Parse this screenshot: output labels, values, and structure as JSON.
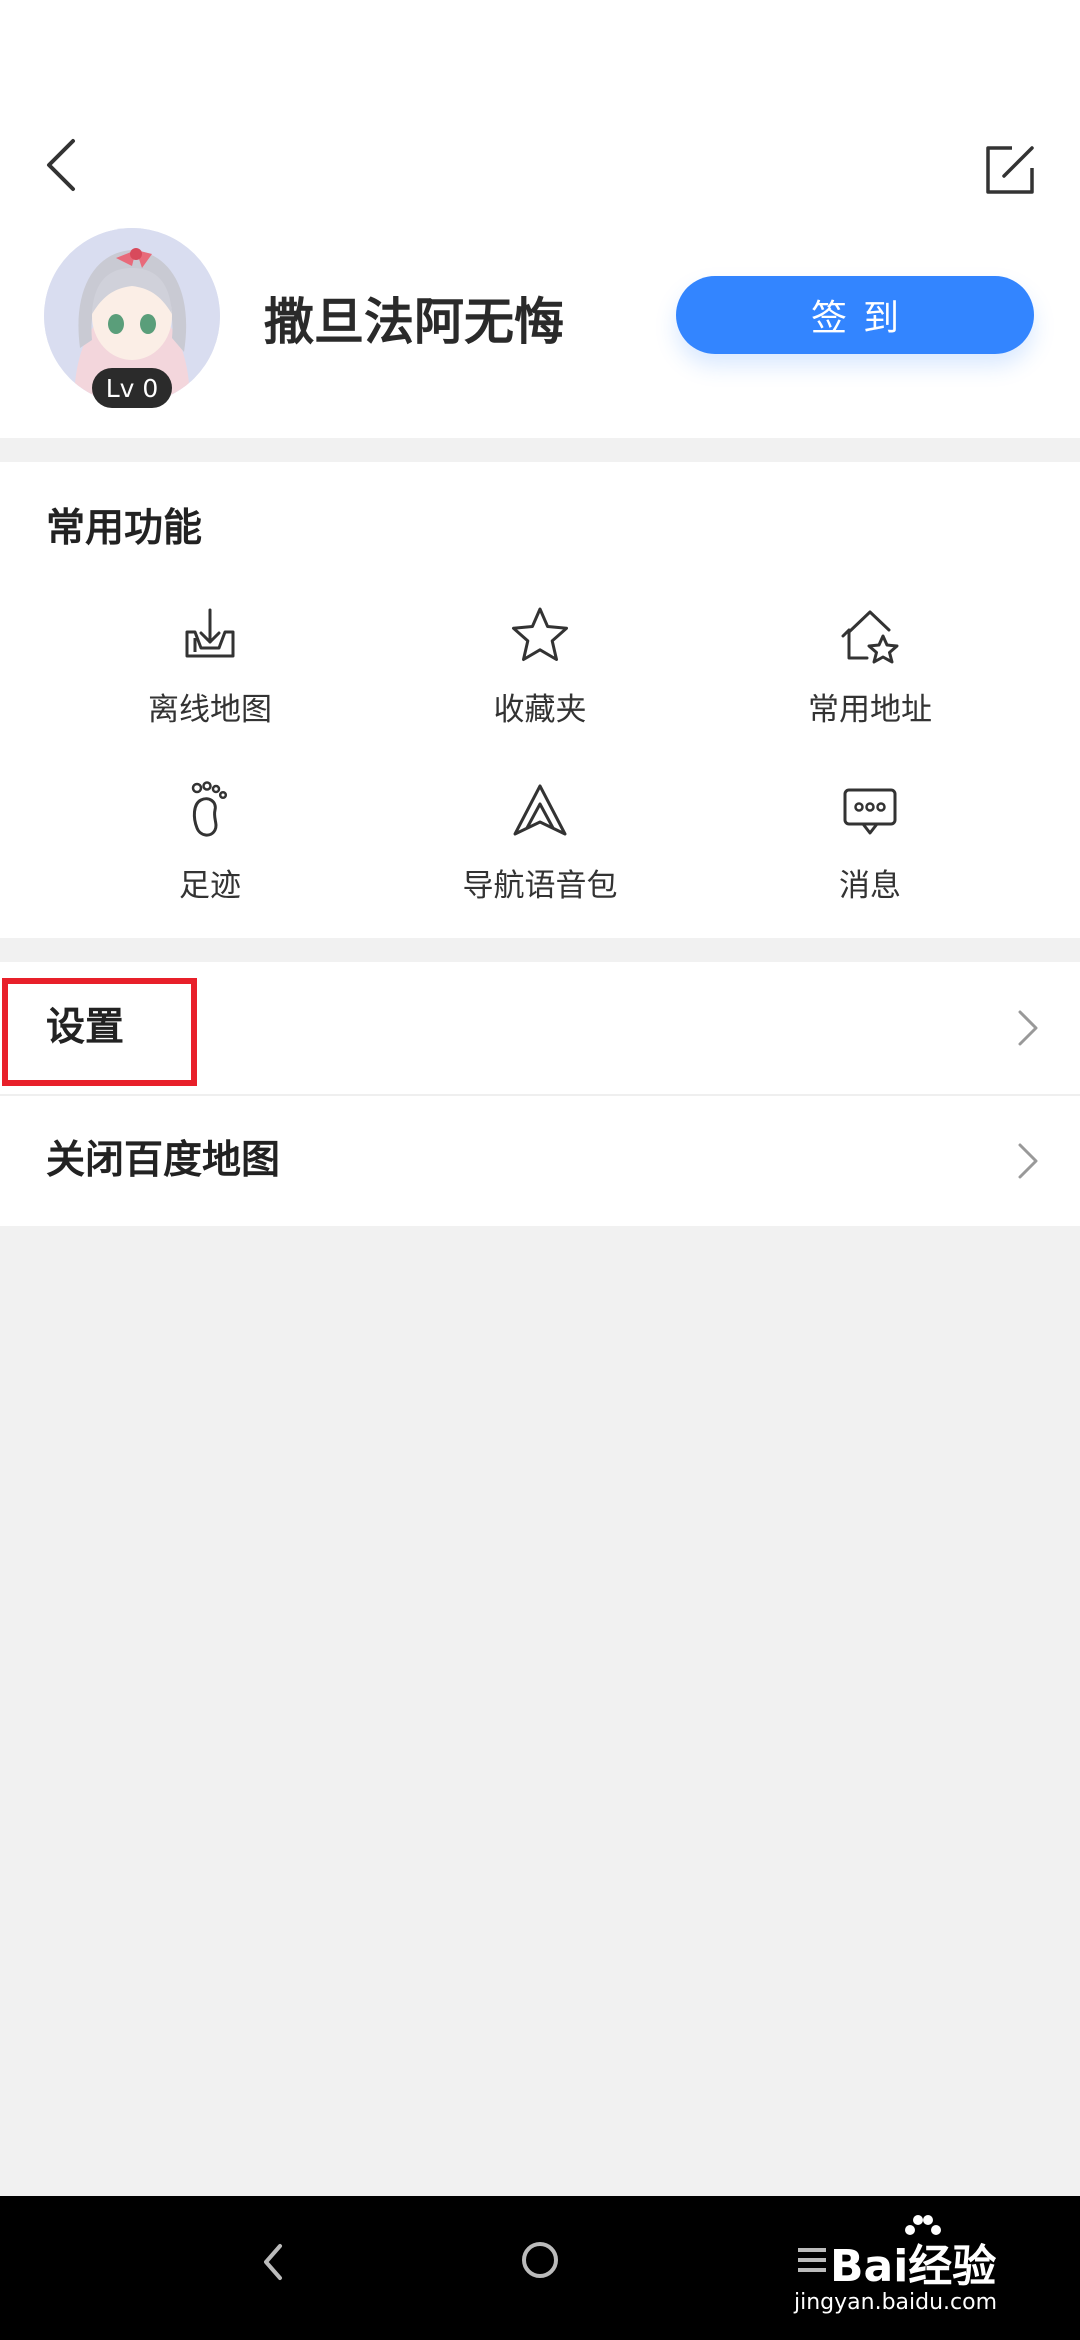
{
  "header": {
    "user_name": "撒旦法阿无悔",
    "level_badge": "Lv 0",
    "signin_label": "签到",
    "back_icon": "back-arrow-icon",
    "edit_icon": "edit-icon"
  },
  "common_functions": {
    "title": "常用功能",
    "items": [
      {
        "label": "离线地图",
        "icon": "offline-map-download-icon"
      },
      {
        "label": "收藏夹",
        "icon": "star-icon"
      },
      {
        "label": "常用地址",
        "icon": "home-star-icon"
      },
      {
        "label": "足迹",
        "icon": "footprint-icon"
      },
      {
        "label": "导航语音包",
        "icon": "navigation-arrow-icon"
      },
      {
        "label": "消息",
        "icon": "message-icon"
      }
    ]
  },
  "menu": {
    "items": [
      {
        "label": "设置",
        "highlighted": true
      },
      {
        "label": "关闭百度地图"
      }
    ]
  },
  "watermark": {
    "logo_text": "Bai经验",
    "url": "jingyan.baidu.com"
  },
  "colors": {
    "accent": "#3385ff",
    "highlight": "#e8202a",
    "background": "#f1f1f1"
  }
}
